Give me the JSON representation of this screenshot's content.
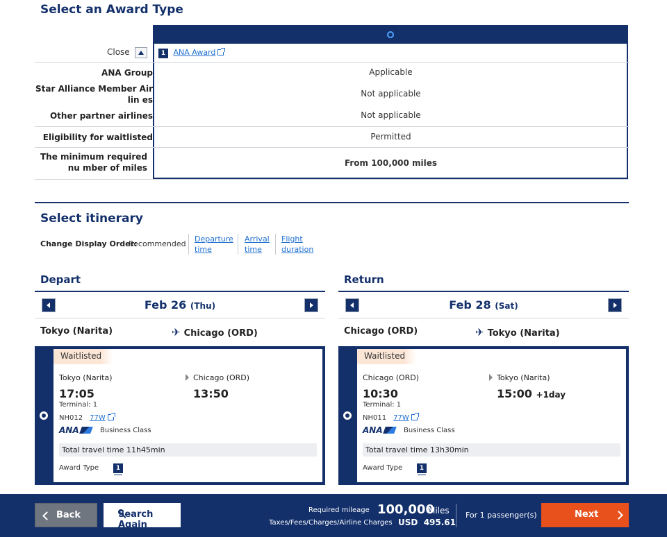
{
  "award_section": {
    "title": "Select an Award Type",
    "close_label": "Close",
    "award_badge": "1",
    "award_link": "ANA Award",
    "rows": [
      {
        "label": "ANA Group",
        "value": "Applicable"
      },
      {
        "label": "Star Alliance Member Airlin es",
        "value": "Not applicable"
      },
      {
        "label": "Other partner airlines",
        "value": "Not applicable"
      },
      {
        "label": "Eligibility for waitlisted",
        "value": "Permitted"
      },
      {
        "label": "The minimum required nu mber of miles",
        "value": "From 100,000 miles"
      }
    ]
  },
  "itinerary": {
    "title": "Select itinerary",
    "sort_label": "Change Display Order:",
    "sort_current": "Recommended",
    "sort_options": [
      "Departure time",
      "Arrival time",
      "Flight duration"
    ]
  },
  "depart": {
    "heading": "Depart",
    "date": "Feb 26",
    "day": "(Thu)",
    "from": "Tokyo (Narita)",
    "to": "Chicago (ORD)",
    "flight": {
      "status": "Waitlisted",
      "dep_city": "Tokyo (Narita)",
      "dep_time": "17:05",
      "arr_city": "Chicago (ORD)",
      "arr_time": "13:50",
      "arr_offset": "",
      "terminal": "Terminal: 1",
      "flight_no": "NH012",
      "aircraft": "77W",
      "airline_logo": "ANA",
      "cabin": "Business Class",
      "travel_time": "Total travel time 11h45min",
      "award_type_label": "Award Type",
      "award_badge": "1"
    }
  },
  "return": {
    "heading": "Return",
    "date": "Feb 28",
    "day": "(Sat)",
    "from": "Chicago (ORD)",
    "to": "Tokyo (Narita)",
    "flight": {
      "status": "Waitlisted",
      "dep_city": "Chicago (ORD)",
      "dep_time": "10:30",
      "arr_city": "Tokyo (Narita)",
      "arr_time": "15:00",
      "arr_offset": "+1day",
      "terminal": "Terminal: 1",
      "flight_no": "NH011",
      "aircraft": "77W",
      "airline_logo": "ANA",
      "cabin": "Business Class",
      "travel_time": "Total travel time 13h30min",
      "award_type_label": "Award Type",
      "award_badge": "1"
    }
  },
  "footer": {
    "back_label": "Back",
    "search_again_label": "Search Again",
    "mileage_label": "Required mileage",
    "mileage_value": "100,000",
    "mileage_unit": "Miles",
    "tax_label": "Taxes/Fees/Charges/Airline Charges",
    "tax_value": "USD  495.61",
    "passengers": "For 1 passenger(s)",
    "next_label": "Next"
  },
  "colors": {
    "navy": "#13306b",
    "accent_orange": "#e8501c",
    "link": "#1e6fd0",
    "waitlist_bg": "#fbe6d6"
  }
}
